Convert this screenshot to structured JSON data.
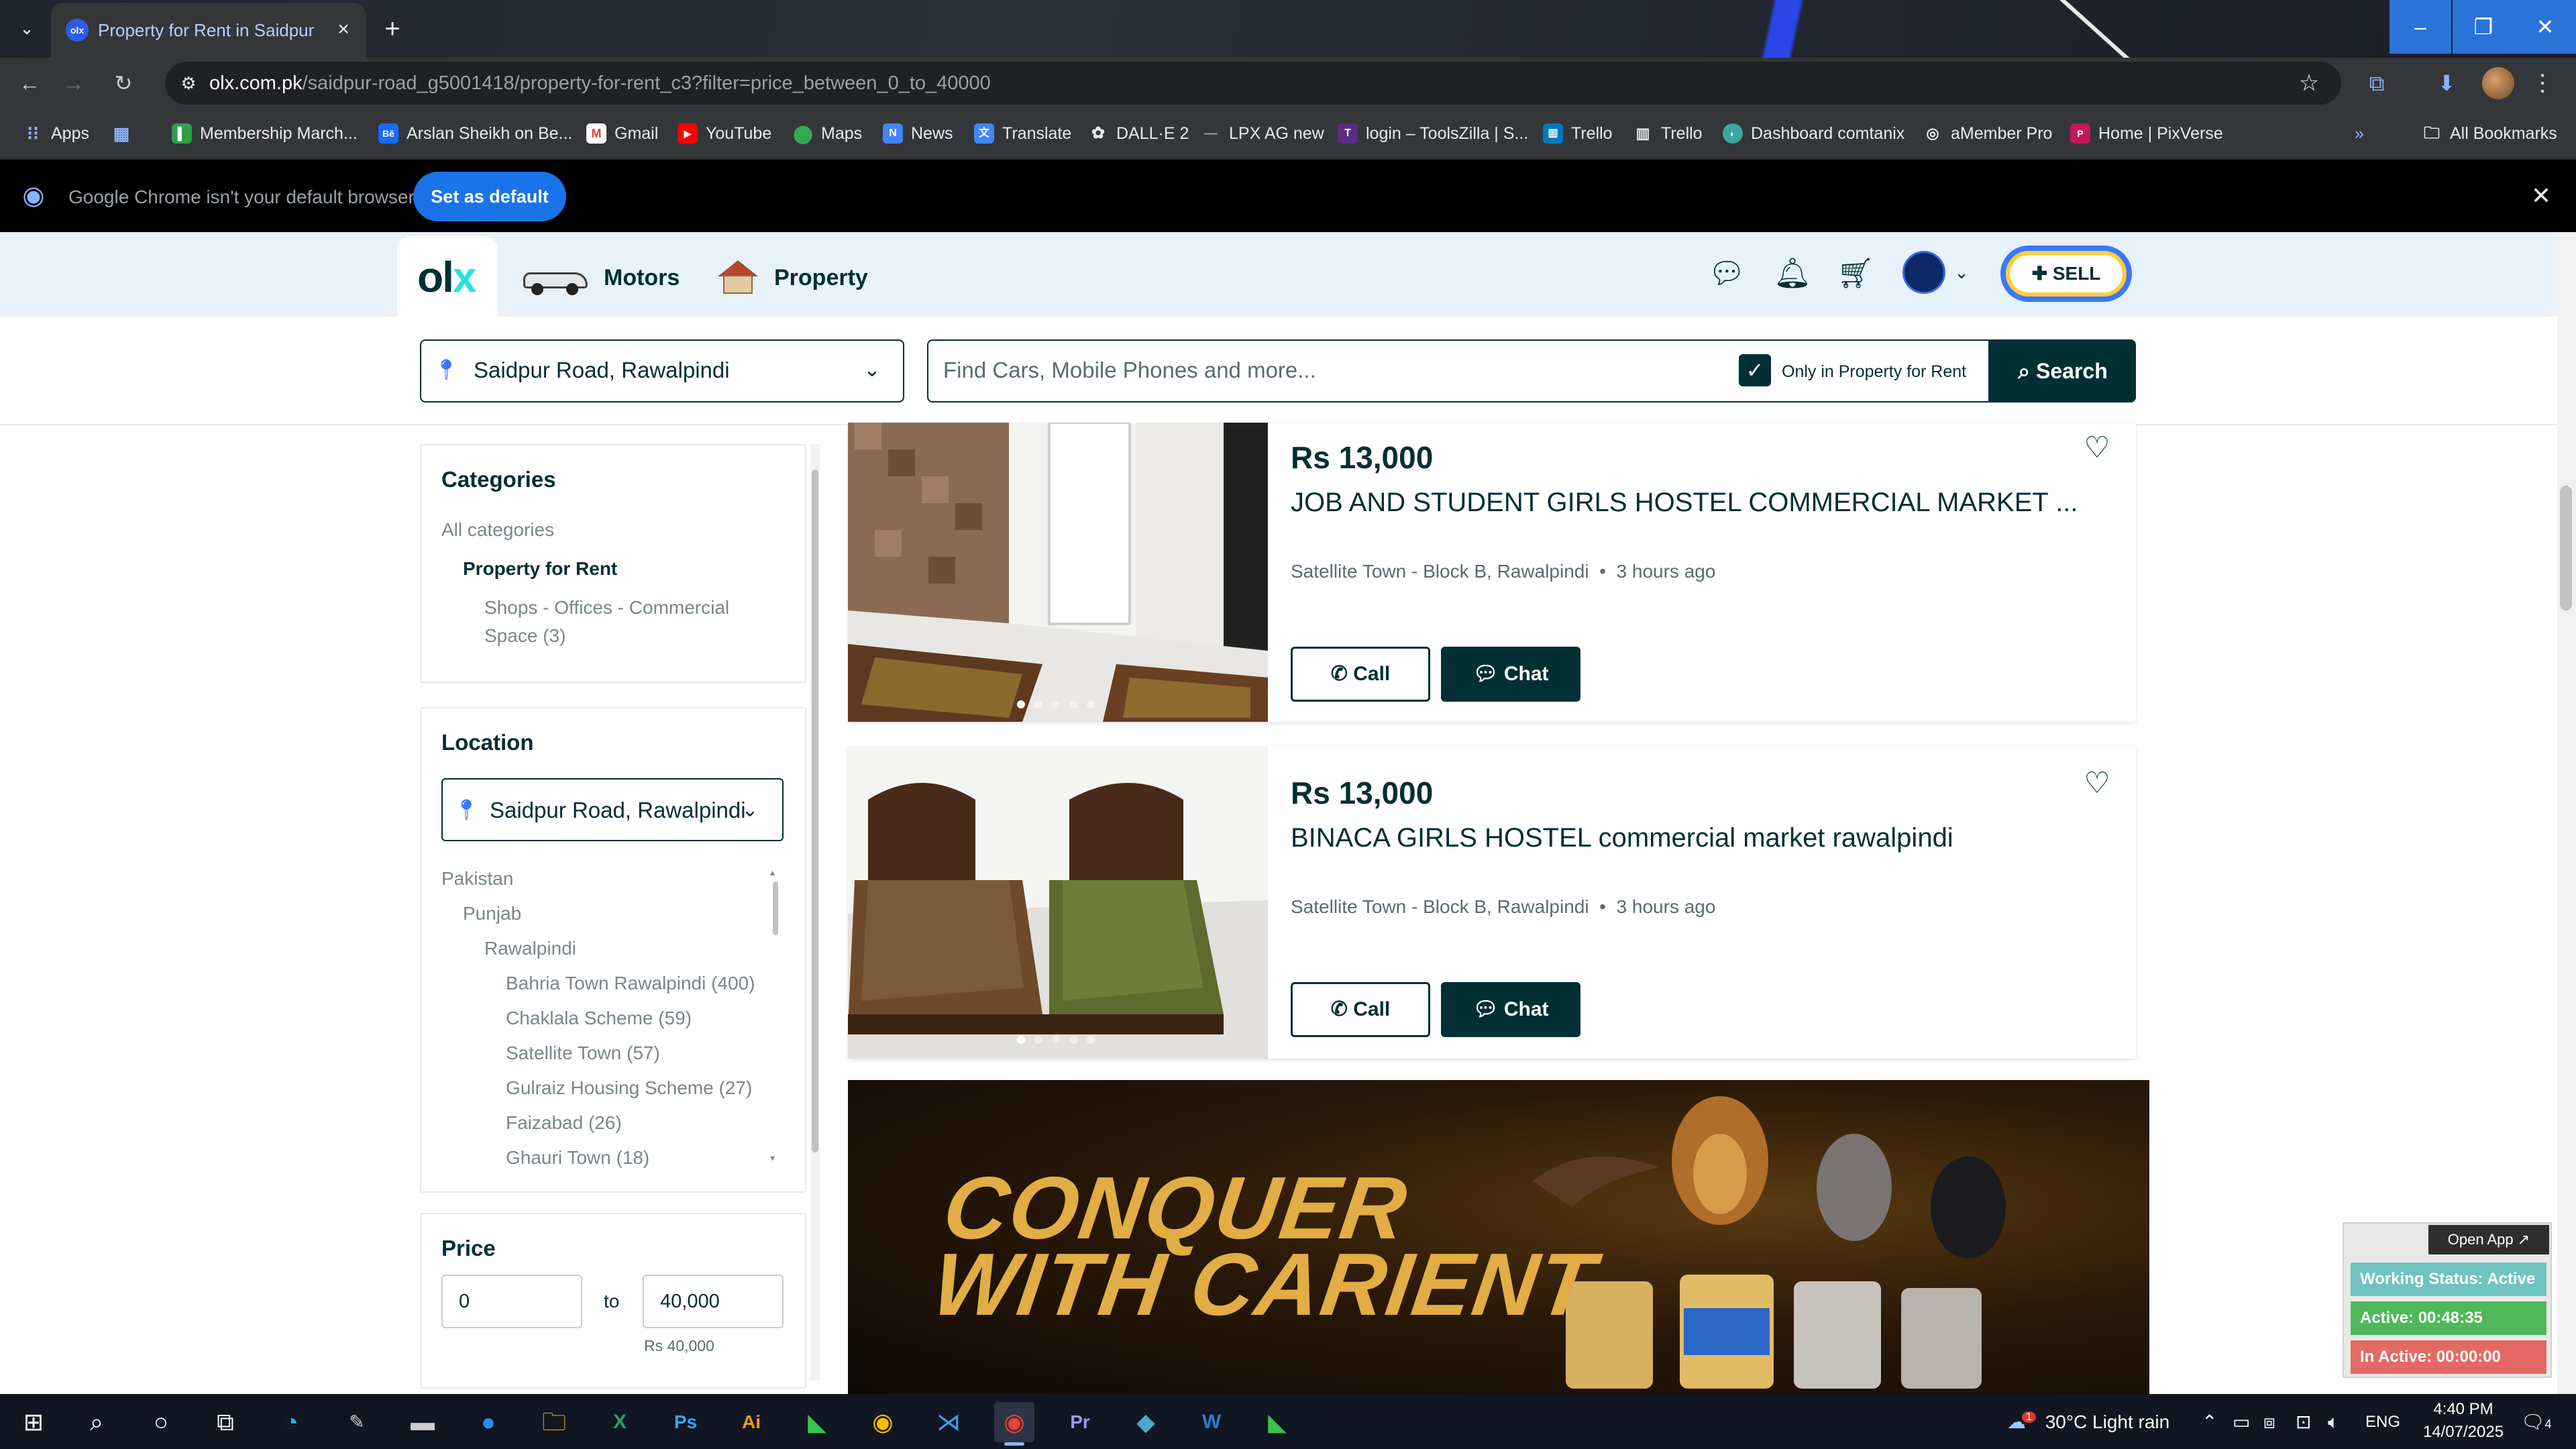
{
  "browser": {
    "tab_title": "Property for Rent in Saidpur Ro",
    "tab_favicon_text": "olx",
    "url_host": "olx.com.pk",
    "url_path": "/saidpur-road_g5001418/property-for-rent_c3?filter=price_between_0_to_40000",
    "bookmarks": [
      {
        "label": "Apps",
        "icon": "apps-grid-icon"
      },
      {
        "label": "Membership March...",
        "icon": "green-bookmark-icon"
      },
      {
        "label": "Arslan Sheikh on Be...",
        "icon": "behance-icon"
      },
      {
        "label": "Gmail",
        "icon": "gmail-icon"
      },
      {
        "label": "YouTube",
        "icon": "youtube-icon"
      },
      {
        "label": "Maps",
        "icon": "maps-icon"
      },
      {
        "label": "News",
        "icon": "news-icon"
      },
      {
        "label": "Translate",
        "icon": "translate-icon"
      },
      {
        "label": "DALL·E 2",
        "icon": "openai-icon"
      },
      {
        "label": "LPX AG new",
        "icon": "lpx-icon"
      },
      {
        "label": "login – ToolsZilla | S...",
        "icon": "toolszilla-icon"
      },
      {
        "label": "Trello",
        "icon": "trello-icon"
      },
      {
        "label": "Trello",
        "icon": "trello-icon"
      },
      {
        "label": "Dashboard comtanix",
        "icon": "dashboard-icon"
      },
      {
        "label": "aMember Pro",
        "icon": "amember-icon"
      },
      {
        "label": "Home | PixVerse",
        "icon": "pixverse-icon"
      }
    ],
    "all_bookmarks_label": "All Bookmarks",
    "infobar_text": "Google Chrome isn't your default browser",
    "infobar_button": "Set as default"
  },
  "header": {
    "logo": "olx",
    "nav": [
      {
        "label": "Motors"
      },
      {
        "label": "Property"
      }
    ],
    "sell_label": "SELL"
  },
  "search": {
    "location_value": "Saidpur Road, Rawalpindi",
    "query_placeholder": "Find Cars, Mobile Phones and more...",
    "scope_label": "Only in Property for Rent",
    "scope_checked": true,
    "button_label": "Search"
  },
  "sidebar": {
    "categories_title": "Categories",
    "all_categories": "All categories",
    "current_category": "Property for Rent",
    "subcategory_line1": "Shops - Offices - Commercial",
    "subcategory_line2": "Space (3)",
    "location_title": "Location",
    "location_value": "Saidpur Road, Rawalpindi",
    "tree": {
      "country": "Pakistan",
      "province": "Punjab",
      "city": "Rawalpindi",
      "areas": [
        "Bahria Town Rawalpindi (400)",
        "Chaklala Scheme (59)",
        "Satellite Town (57)",
        "Gulraiz Housing Scheme (27)",
        "Faizabad (26)",
        "Ghauri Town (18)"
      ]
    },
    "price_title": "Price",
    "price_min": "0",
    "price_to": "to",
    "price_max": "40,000",
    "price_max_caption": "Rs 40,000"
  },
  "listings": [
    {
      "price": "Rs 13,000",
      "title": "JOB AND STUDENT GIRLS HOSTEL COMMERCIAL MARKET ...",
      "location": "Satellite Town - Block B, Rawalpindi",
      "time": "3 hours ago",
      "call_label": "Call",
      "chat_label": "Chat"
    },
    {
      "price": "Rs 13,000",
      "title": "BINACA GIRLS HOSTEL commercial market rawalpindi",
      "location": "Satellite Town - Block B, Rawalpindi",
      "time": "3 hours ago",
      "call_label": "Call",
      "chat_label": "Chat"
    }
  ],
  "ad": {
    "line1": "CONQUER",
    "line2": "WITH CARIENT"
  },
  "work_widget": {
    "open_app": "Open App ↗",
    "status": "Working Status: Active",
    "active": "Active: 00:48:35",
    "inactive": "In Active: 00:00:00",
    "colors": {
      "status": "#6fc3c0",
      "active": "#4fb85a",
      "inactive": "#e36a64"
    }
  },
  "taskbar": {
    "weather_temp": "30°C",
    "weather_text": "Light rain",
    "weather_badge": "1",
    "language": "ENG",
    "time": "4:40 PM",
    "date": "14/07/2025",
    "notifications": "4"
  },
  "colors": {
    "olx_dark": "#002f34",
    "olx_teal": "#23e5db",
    "olx_blue": "#3a77ff",
    "chrome_blue": "#1a73e8"
  }
}
